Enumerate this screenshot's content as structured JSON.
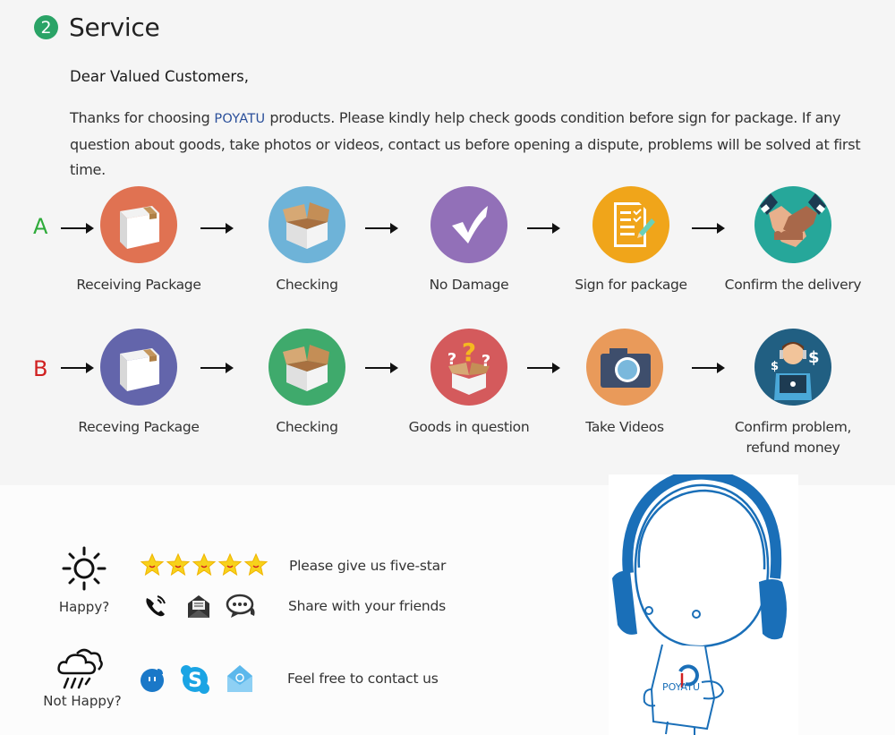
{
  "header": {
    "step_number": "2",
    "title": "Service"
  },
  "greeting": "Dear Valued Customers,",
  "intro": {
    "before_brand": "Thanks for choosing ",
    "brand": "POYATU",
    "after_brand": " products. Please kindly help check goods condition before sign for package. If any question about goods, take photos or videos, contact us before opening a dispute, problems will be solved at first time."
  },
  "colors": {
    "accent_green": "#2aa366",
    "row_a_letter": "#2eab3a",
    "row_b_letter": "#d02020",
    "brand_blue": "#2a4f9a",
    "mascot_blue": "#1a6fb8"
  },
  "flows": [
    {
      "letter": "A",
      "steps": [
        {
          "label": "Receiving Package",
          "icon": "closed-box-icon",
          "color": "#e07252"
        },
        {
          "label": "Checking",
          "icon": "open-box-icon",
          "color": "#6eb3d8"
        },
        {
          "label": "No Damage",
          "icon": "checkmark-icon",
          "color": "#9270b8"
        },
        {
          "label": "Sign for package",
          "icon": "signed-document-icon",
          "color": "#f0a51a"
        },
        {
          "label": "Confirm the delivery",
          "icon": "handshake-icon",
          "color": "#26a79a"
        }
      ]
    },
    {
      "letter": "B",
      "steps": [
        {
          "label": "Receving Package",
          "icon": "closed-box-icon",
          "color": "#6365ab"
        },
        {
          "label": "Checking",
          "icon": "open-box-icon",
          "color": "#3faa6c"
        },
        {
          "label": "Goods in question",
          "icon": "question-box-icon",
          "color": "#d45a5c"
        },
        {
          "label": "Take Videos",
          "icon": "camera-icon",
          "color": "#e99a5a"
        },
        {
          "label": "Confirm problem,\nrefund money",
          "icon": "support-agent-icon",
          "color": "#215f82"
        }
      ]
    }
  ],
  "feedback": {
    "happy": {
      "label": "Happy?",
      "icon": "sun-icon",
      "lines": [
        {
          "text": "Please give us five-star",
          "icons": [
            "star-icon",
            "star-icon",
            "star-icon",
            "star-icon",
            "star-icon"
          ]
        },
        {
          "text": "Share with your friends",
          "icons": [
            "phone-icon",
            "envelope-icon",
            "chat-bubble-icon"
          ]
        }
      ]
    },
    "not_happy": {
      "label": "Not Happy?",
      "icon": "rain-cloud-icon",
      "lines": [
        {
          "text": "Feel free to contact us",
          "icons": [
            "messenger-icon",
            "skype-icon",
            "email-icon"
          ]
        }
      ]
    },
    "rating_stars": 5
  },
  "mascot": {
    "brand": "POYATU",
    "description": "headphone-mascot"
  }
}
